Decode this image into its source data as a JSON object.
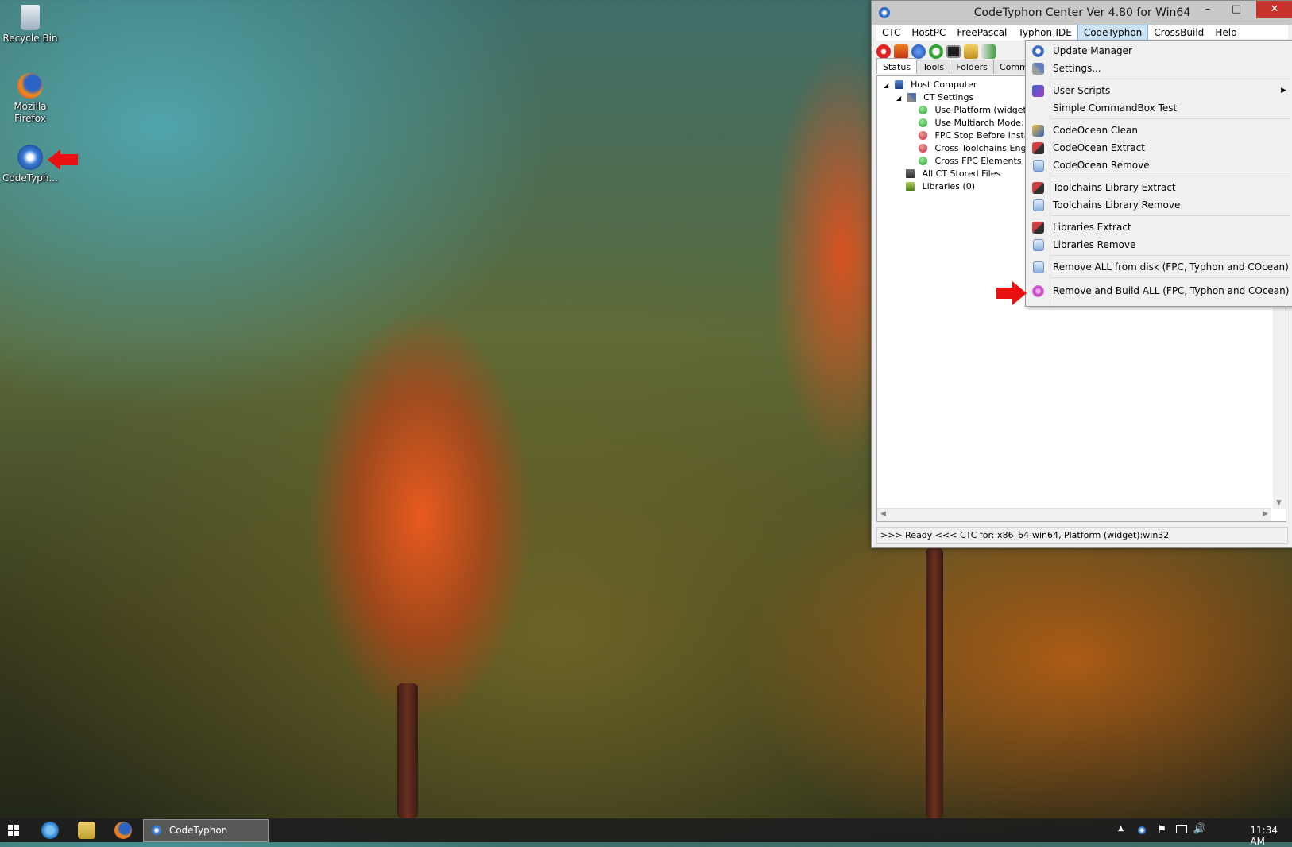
{
  "desktop": {
    "icons": [
      {
        "label": "Recycle Bin"
      },
      {
        "label": "Mozilla\nFirefox",
        "line1": "Mozilla",
        "line2": "Firefox"
      },
      {
        "label": "CodeTyph..."
      }
    ]
  },
  "window": {
    "title": "CodeTyphon Center Ver 4.80 for Win64",
    "controls": {
      "minimize": "–",
      "maximize": "□",
      "close": "✕"
    },
    "menu": [
      "CTC",
      "HostPC",
      "FreePascal",
      "Typhon-IDE",
      "CodeTyphon",
      "CrossBuild",
      "Help"
    ],
    "active_menu": "CodeTyphon",
    "tabs": [
      "Status",
      "Tools",
      "Folders",
      "Commanc"
    ],
    "tree": {
      "root": "Host Computer",
      "ct_settings": "CT Settings",
      "settings_items": [
        {
          "label": "Use Platform (widget): w",
          "status": "green"
        },
        {
          "label": "Use Multiarch Mode: Tru",
          "status": "green"
        },
        {
          "label": "FPC Stop Before Install:",
          "status": "red"
        },
        {
          "label": "Cross Toolchains Engine",
          "status": "red"
        },
        {
          "label": "Cross FPC Elements Eng",
          "status": "green"
        }
      ],
      "stored_files": "All CT Stored Files",
      "libraries": "Libraries (0)"
    },
    "status_bar": ">>> Ready <<<   CTC for: x86_64-win64, Platform (widget):win32"
  },
  "dropdown": {
    "items": [
      {
        "label": "Update Manager",
        "icon": "update-icon"
      },
      {
        "label": "Settings...",
        "icon": "tools-icon"
      },
      {
        "label": "User Scripts",
        "icon": "scripts-icon",
        "submenu": true
      },
      {
        "label": "Simple CommandBox Test",
        "icon": ""
      },
      {
        "label": "CodeOcean Clean",
        "icon": "clean-icon"
      },
      {
        "label": "CodeOcean Extract",
        "icon": "extract-icon"
      },
      {
        "label": "CodeOcean Remove",
        "icon": "remove-icon"
      },
      {
        "label": "Toolchains Library Extract",
        "icon": "extract-icon"
      },
      {
        "label": "Toolchains Library Remove",
        "icon": "remove-icon"
      },
      {
        "label": "Libraries Extract",
        "icon": "extract-icon"
      },
      {
        "label": "Libraries Remove",
        "icon": "remove-icon"
      },
      {
        "label": "Remove ALL from disk (FPC, Typhon and COcean)",
        "icon": "remove-icon"
      },
      {
        "label": "Remove and Build ALL (FPC, Typhon and COcean)",
        "icon": "build-icon"
      }
    ],
    "submenu_arrow": "▶"
  },
  "taskbar": {
    "app_label": "CodeTyphon",
    "clock": "11:34 AM"
  },
  "colors": {
    "accent_red": "#e81010",
    "menu_highlight": "#cce4f7",
    "close_button": "#c7332a"
  }
}
